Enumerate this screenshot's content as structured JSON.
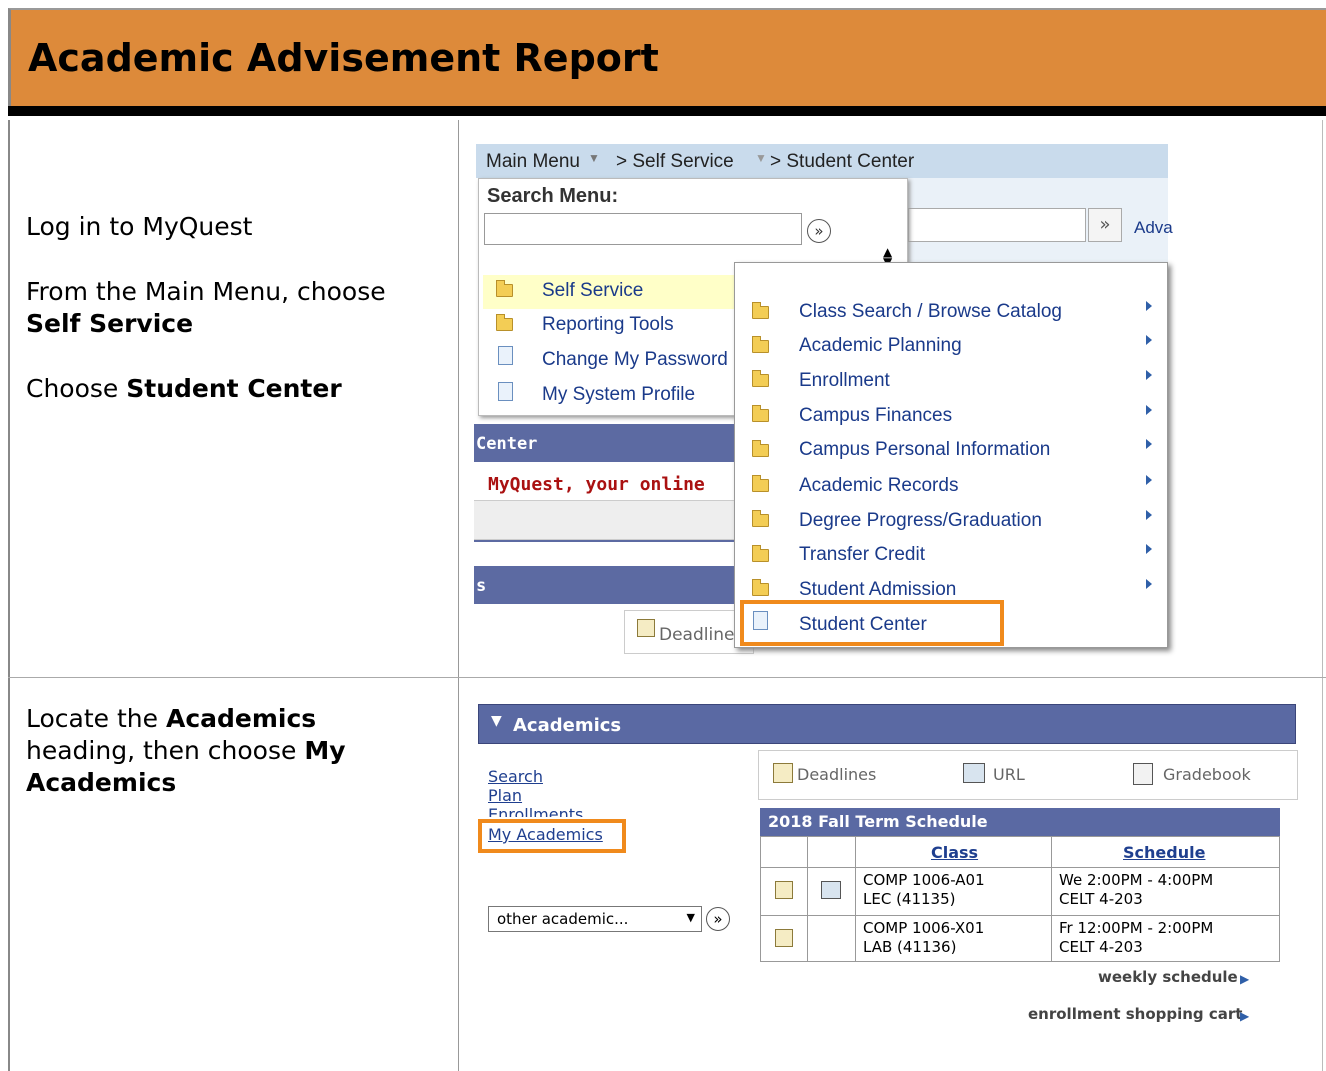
{
  "title": "Academic Advisement Report",
  "step1": {
    "line1": "Log in to MyQuest",
    "line2": "From the Main Menu, choose",
    "line2_bold": "Self Service",
    "line3": "Choose",
    "line3_bold": "Student Center"
  },
  "step2": {
    "text1": "Locate the",
    "bold1": "Academics",
    "text2": "heading, then choose",
    "bold2": "My",
    "bold3": "Academics"
  },
  "shot1": {
    "breadcrumb_main": "Main Menu",
    "breadcrumb_self": "> Self Service",
    "breadcrumb_student": "> Student Center",
    "search_label": "Search Menu:",
    "adv_label": "Adva",
    "menu1": [
      "Self Service",
      "Reporting Tools",
      "Change My Password",
      "My System Profile"
    ],
    "menu2": [
      "Class Search / Browse Catalog",
      "Academic Planning",
      "Enrollment",
      "Campus Finances",
      "Campus Personal Information",
      "Academic Records",
      "Degree Progress/Graduation",
      "Transfer Credit",
      "Student Admission",
      "Student Center"
    ],
    "bg_center": "Center",
    "bg_welcome": "MyQuest, your online",
    "bg_s": "s",
    "bg_deadline": "Deadline"
  },
  "shot2": {
    "header": "Academics",
    "links": [
      "Search",
      "Plan",
      "Enrollments",
      "My Academics"
    ],
    "select_value": "other academic...",
    "tab_deadlines": "Deadlines",
    "tab_url": "URL",
    "tab_gradebook": "Gradebook",
    "schedule_title": "2018 Fall Term Schedule",
    "col_class": "Class",
    "col_schedule": "Schedule",
    "rows": [
      {
        "class1": "COMP 1006-A01",
        "class2": "LEC (41135)",
        "sched1": "We 2:00PM - 4:00PM",
        "sched2": "CELT 4-203"
      },
      {
        "class1": "COMP 1006-X01",
        "class2": "LAB (41136)",
        "sched1": "Fr 12:00PM - 2:00PM",
        "sched2": "CELT 4-203"
      }
    ],
    "weekly": "weekly schedule",
    "cart": "enrollment shopping cart"
  },
  "colors": {
    "banner": "#dd8a3a",
    "highlight": "#f08a1c",
    "bar": "#5a69a3"
  }
}
